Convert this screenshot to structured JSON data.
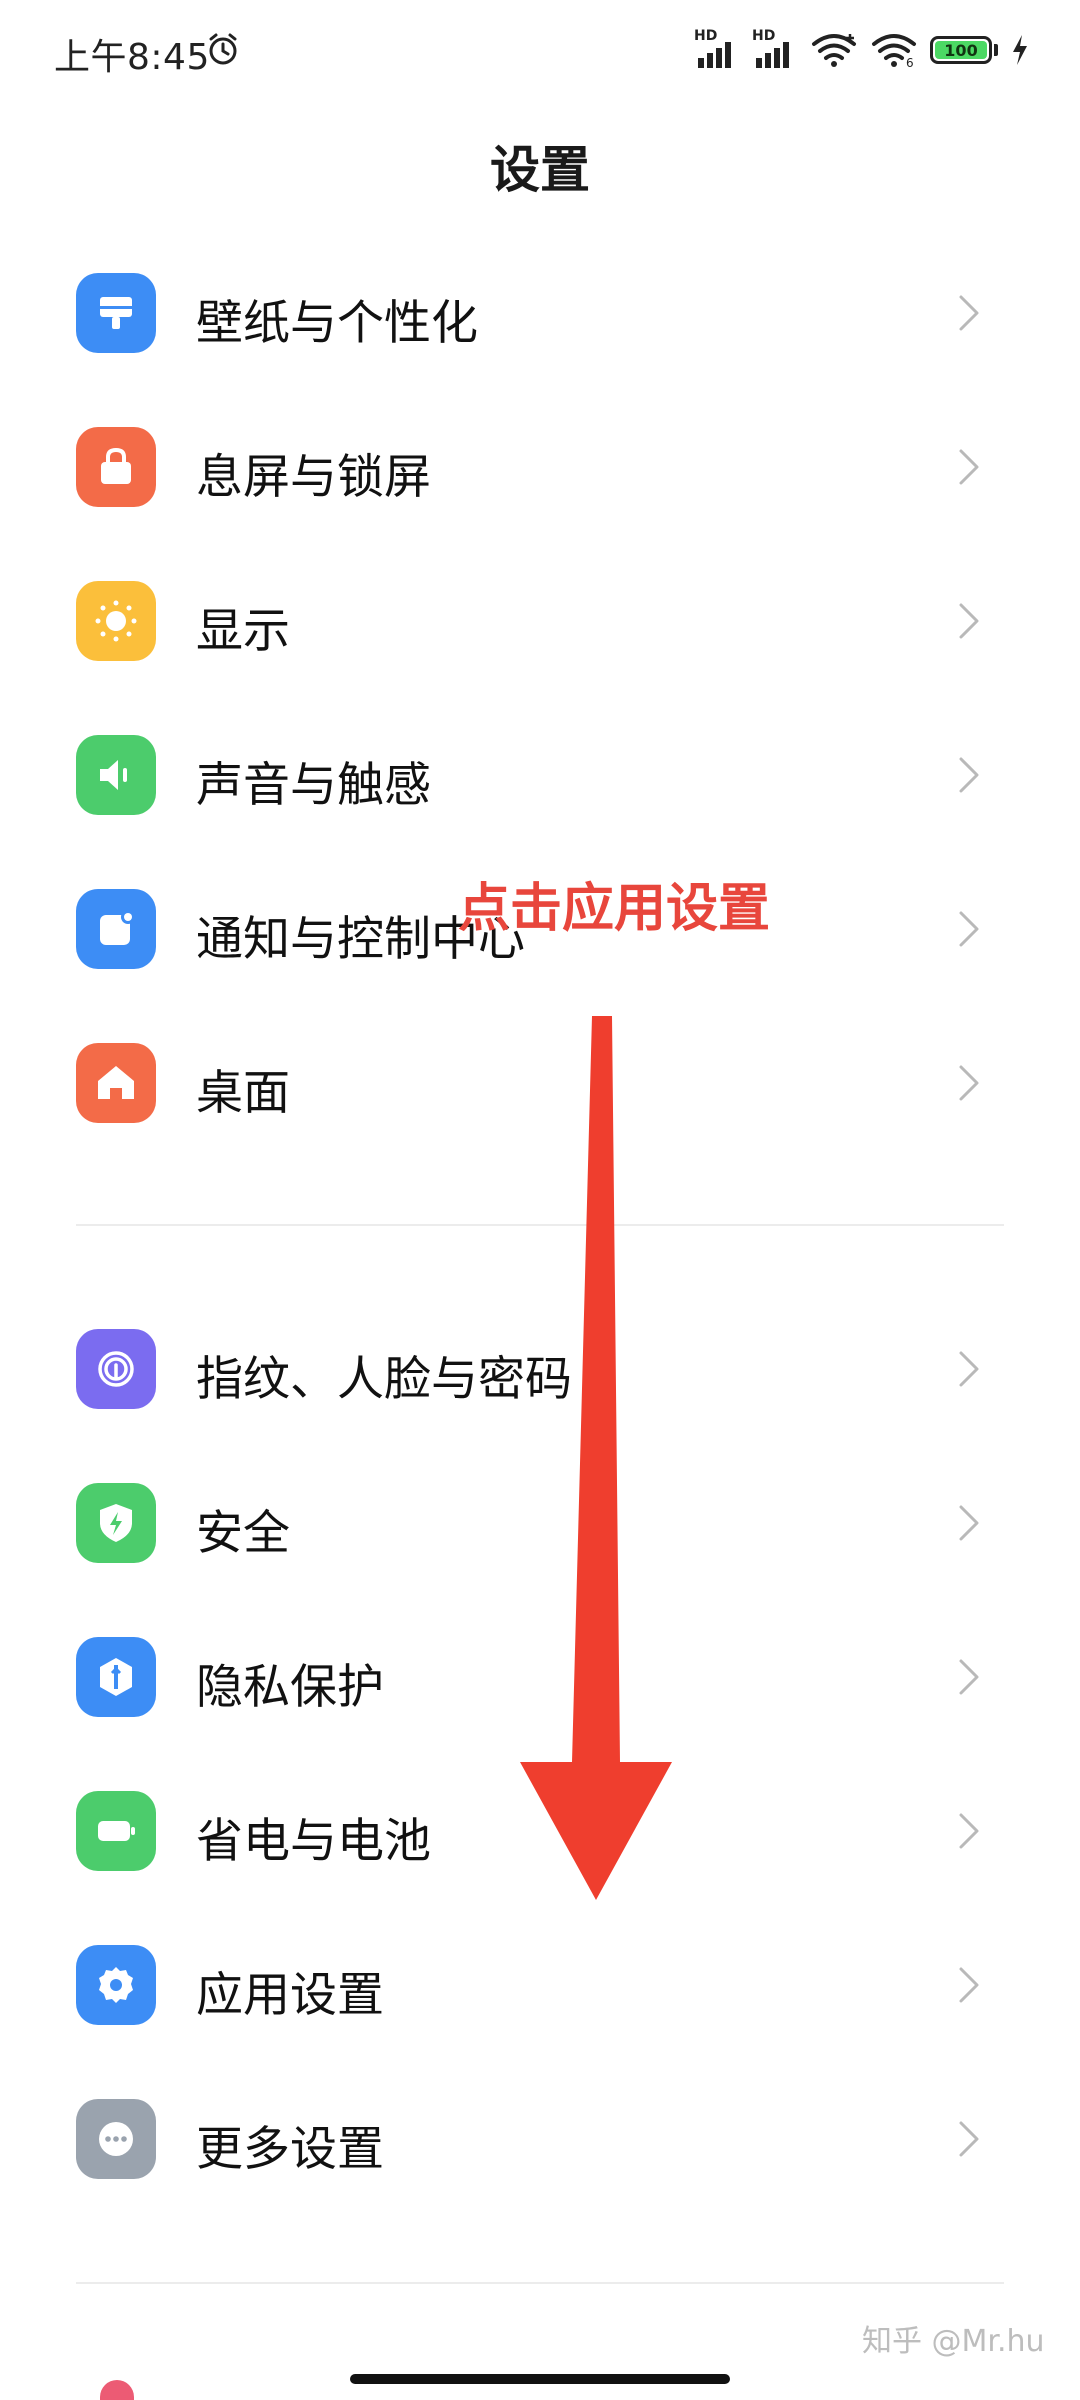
{
  "status_bar": {
    "time": "上午8:45",
    "icons": [
      "alarm-icon",
      "signal-icon",
      "signal-icon",
      "wifi-icon",
      "wifi-icon",
      "battery-icon",
      "charging-icon"
    ],
    "signal_badge": "HD",
    "battery_level": "100",
    "battery_color": "#4cd964"
  },
  "header": {
    "title": "设置"
  },
  "groups": [
    {
      "items": [
        {
          "label": "壁纸与个性化",
          "icon": "wallpaper-icon",
          "color": "#3d8df5"
        },
        {
          "label": "息屏与锁屏",
          "icon": "lock-icon",
          "color": "#f36b48"
        },
        {
          "label": "显示",
          "icon": "sun-icon",
          "color": "#fbbf3b"
        },
        {
          "label": "声音与触感",
          "icon": "speaker-icon",
          "color": "#4ccc6c"
        },
        {
          "label": "通知与控制中心",
          "icon": "notification-icon",
          "color": "#3d8df5"
        },
        {
          "label": "桌面",
          "icon": "home-icon",
          "color": "#f36b48"
        }
      ]
    },
    {
      "items": [
        {
          "label": "指纹、人脸与密码",
          "icon": "fingerprint-icon",
          "color": "#7b6cf0"
        },
        {
          "label": "安全",
          "icon": "shield-icon",
          "color": "#4ccc6c"
        },
        {
          "label": "隐私保护",
          "icon": "privacy-icon",
          "color": "#3d8df5"
        },
        {
          "label": "省电与电池",
          "icon": "battery-saver-icon",
          "color": "#4ccc6c"
        },
        {
          "label": "应用设置",
          "icon": "gear-icon",
          "color": "#3d8df5"
        },
        {
          "label": "更多设置",
          "icon": "more-icon",
          "color": "#9aa3ae"
        }
      ]
    }
  ],
  "annotation": {
    "text": "点击应用设置",
    "color": "#e8463c"
  },
  "watermark": "知乎 @Mr.hu"
}
